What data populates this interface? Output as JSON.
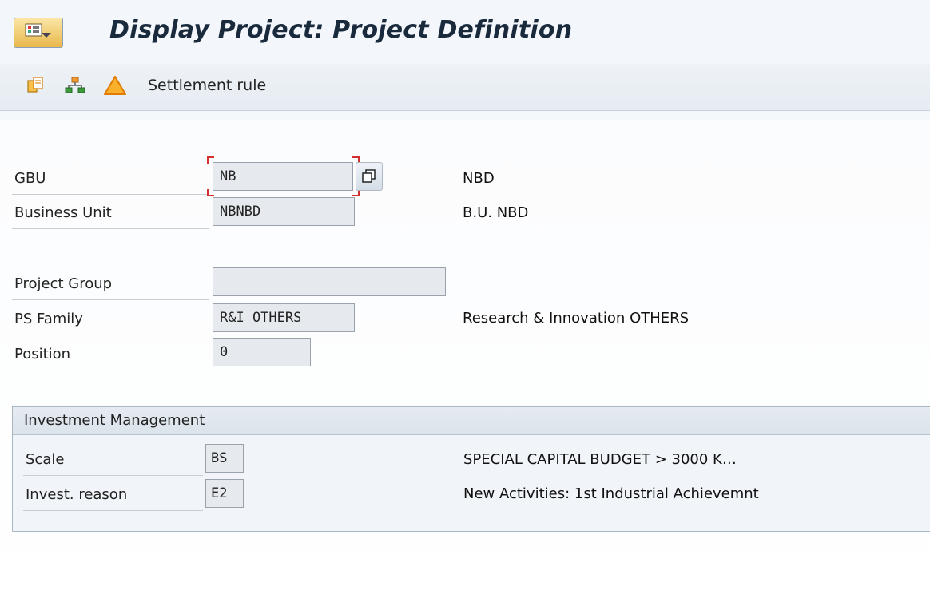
{
  "window": {
    "title": "Display Project: Project Definition"
  },
  "toolbar": {
    "settlement_rule_label": "Settlement rule",
    "icons": [
      "copy-detail-icon",
      "hierarchy-icon",
      "warning-icon"
    ]
  },
  "form": {
    "gbu": {
      "label": "GBU",
      "value": "NB",
      "description": "NBD"
    },
    "business_unit": {
      "label": "Business Unit",
      "value": "NBNBD",
      "description": "B.U. NBD"
    },
    "project_group": {
      "label": "Project Group",
      "value": ""
    },
    "ps_family": {
      "label": "PS Family",
      "value": "R&I OTHERS",
      "description": "Research & Innovation OTHERS"
    },
    "position": {
      "label": "Position",
      "value": "0"
    }
  },
  "investment_management": {
    "header": "Investment Management",
    "scale": {
      "label": "Scale",
      "value": "BS",
      "description": "SPECIAL CAPITAL BUDGET > 3000 K…"
    },
    "invest_reason": {
      "label": "Invest. reason",
      "value": "E2",
      "description": "New Activities: 1st Industrial Achievemnt"
    }
  },
  "colors": {
    "focus_bracket": "#d32f2f",
    "warning": "#f5a623",
    "hierarchy": "#3b9b3b"
  }
}
